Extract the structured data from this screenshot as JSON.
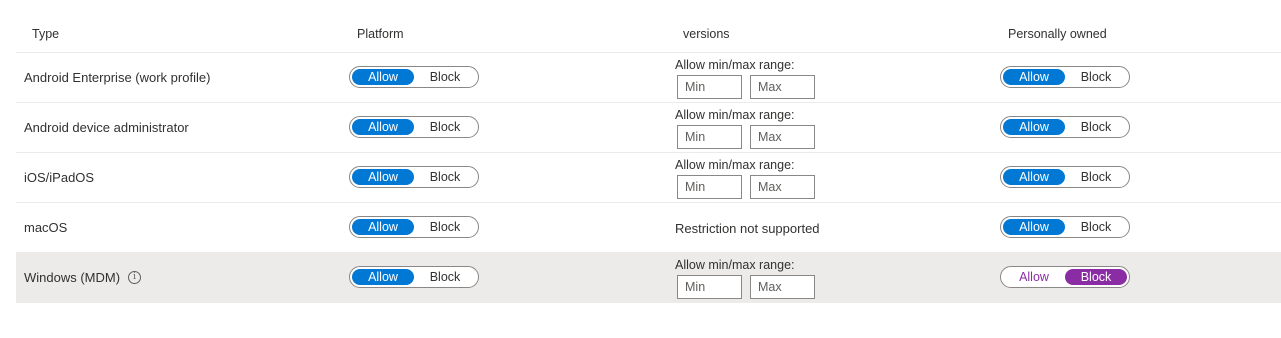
{
  "headers": {
    "type": "Type",
    "platform": "Platform",
    "versions": "versions",
    "personally_owned": "Personally owned"
  },
  "rows": [
    {
      "type": "Android Enterprise (work profile)",
      "platform": {
        "allow": "Allow",
        "block": "Block",
        "selected": "Allow"
      },
      "versions": {
        "label": "Allow min/max range:",
        "min_placeholder": "Min",
        "max_placeholder": "Max"
      },
      "personally_owned": {
        "allow": "Allow",
        "block": "Block",
        "selected": "Allow"
      }
    },
    {
      "type": "Android device administrator",
      "platform": {
        "allow": "Allow",
        "block": "Block",
        "selected": "Allow"
      },
      "versions": {
        "label": "Allow min/max range:",
        "min_placeholder": "Min",
        "max_placeholder": "Max"
      },
      "personally_owned": {
        "allow": "Allow",
        "block": "Block",
        "selected": "Allow"
      }
    },
    {
      "type": "iOS/iPadOS",
      "platform": {
        "allow": "Allow",
        "block": "Block",
        "selected": "Allow"
      },
      "versions": {
        "label": "Allow min/max range:",
        "min_placeholder": "Min",
        "max_placeholder": "Max"
      },
      "personally_owned": {
        "allow": "Allow",
        "block": "Block",
        "selected": "Allow"
      }
    },
    {
      "type": "macOS",
      "platform": {
        "allow": "Allow",
        "block": "Block",
        "selected": "Allow"
      },
      "versions": {
        "text": "Restriction not supported"
      },
      "personally_owned": {
        "allow": "Allow",
        "block": "Block",
        "selected": "Allow"
      }
    },
    {
      "type": "Windows (MDM)",
      "info_icon": "info-icon",
      "platform": {
        "allow": "Allow",
        "block": "Block",
        "selected": "Allow"
      },
      "versions": {
        "label": "Allow min/max range:",
        "min_placeholder": "Min",
        "max_placeholder": "Max"
      },
      "personally_owned": {
        "allow": "Allow",
        "block": "Block",
        "selected": "Block"
      }
    }
  ],
  "colors": {
    "selected_blue": "#0078d4",
    "selected_purple": "#8a2da5",
    "row_highlight": "#edebe9"
  }
}
